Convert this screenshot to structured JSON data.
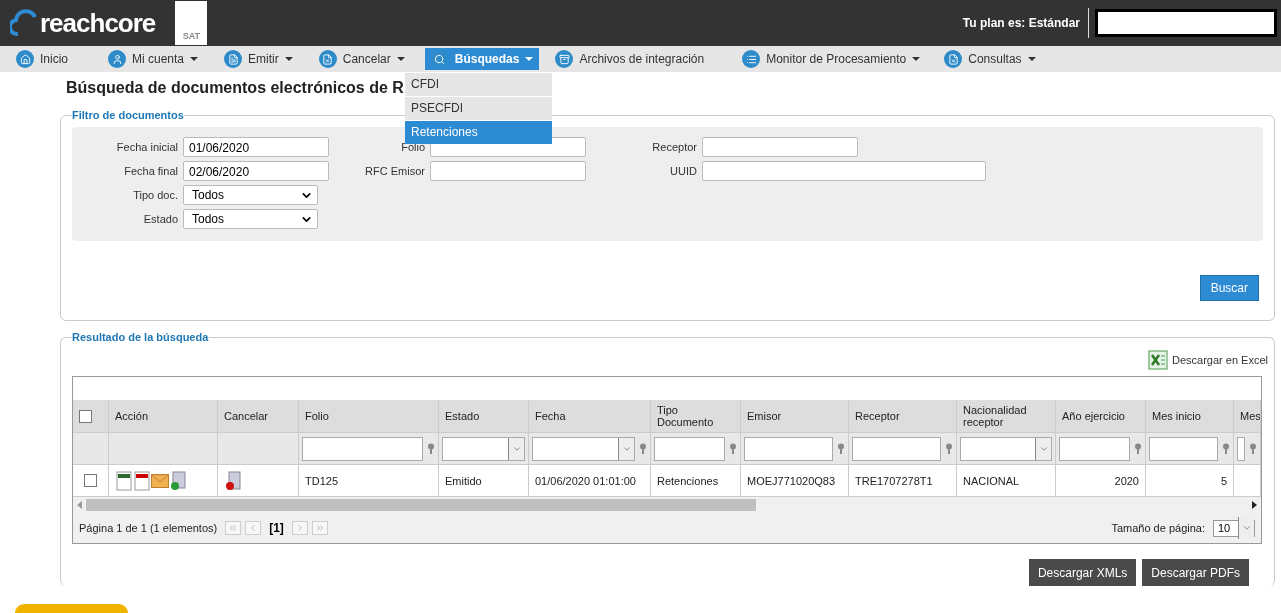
{
  "header": {
    "logo": "reachcore",
    "badge": "SAT",
    "plan": "Tu plan es: Estándar"
  },
  "nav": [
    {
      "label": "Inicio",
      "dropdown": false,
      "selected": false
    },
    {
      "label": "Mi cuenta",
      "dropdown": true,
      "selected": false
    },
    {
      "label": "Emitir",
      "dropdown": true,
      "selected": false
    },
    {
      "label": "Cancelar",
      "dropdown": true,
      "selected": false
    },
    {
      "label": "Búsquedas",
      "dropdown": true,
      "selected": true
    },
    {
      "label": "Archivos de integración",
      "dropdown": false,
      "selected": false
    },
    {
      "label": "Monitor de Procesamiento",
      "dropdown": true,
      "selected": false
    },
    {
      "label": "Consultas",
      "dropdown": true,
      "selected": false
    }
  ],
  "menu": [
    {
      "label": "CFDI",
      "selected": false
    },
    {
      "label": "PSECFDI",
      "selected": false
    },
    {
      "label": "Retenciones",
      "selected": true
    }
  ],
  "title": "Búsqueda de documentos electrónicos de R",
  "filter": {
    "legend": "Filtro de documentos",
    "rows": [
      [
        {
          "label": "Fecha inicial",
          "kind": "text",
          "value": "01/06/2020"
        },
        {
          "label": "Folio",
          "kind": "text"
        },
        {
          "label": "Receptor",
          "kind": "text"
        }
      ],
      [
        {
          "label": "Fecha final",
          "kind": "text",
          "value": "02/06/2020"
        },
        {
          "label": "RFC Emisor",
          "kind": "text"
        },
        {
          "label": "UUID",
          "kind": "wide"
        }
      ],
      [
        {
          "label": "Tipo doc.",
          "kind": "select",
          "value": "Todos"
        }
      ],
      [
        {
          "label": "Estado",
          "kind": "select",
          "value": "Todos"
        }
      ]
    ],
    "button": "Buscar"
  },
  "results": {
    "legend": "Resultado de la búsqueda",
    "excel": "Descargar en Excel",
    "columns": [
      {
        "kind": "check"
      },
      {
        "label": "Acción",
        "kind": "actions"
      },
      {
        "label": "Cancelar",
        "kind": "cancel"
      },
      {
        "label": "Folio",
        "kind": "text"
      },
      {
        "label": "Estado",
        "kind": "text"
      },
      {
        "label": "Fecha",
        "kind": "text"
      },
      {
        "label": "Tipo Documento",
        "kind": "text"
      },
      {
        "label": "Emisor",
        "kind": "text"
      },
      {
        "label": "Receptor",
        "kind": "text"
      },
      {
        "label": "Nacionalidad receptor",
        "kind": "text"
      },
      {
        "label": "Año ejercicio",
        "kind": "number"
      },
      {
        "label": "Mes inicio",
        "kind": "number"
      },
      {
        "label": "Mes",
        "kind": "text"
      }
    ],
    "filters": [
      {
        "kind": "none"
      },
      {
        "kind": "none"
      },
      {
        "kind": "none"
      },
      {
        "kind": "text"
      },
      {
        "kind": "select"
      },
      {
        "kind": "select-funnel"
      },
      {
        "kind": "text"
      },
      {
        "kind": "text"
      },
      {
        "kind": "text"
      },
      {
        "kind": "select"
      },
      {
        "kind": "text"
      },
      {
        "kind": "text"
      },
      {
        "kind": "text"
      }
    ],
    "rows": [
      {
        "checked": false,
        "cells": [
          "",
          "",
          "",
          "TD125",
          "Emitido",
          "01/06/2020 01:01:00",
          "Retenciones",
          "MOEJ771020Q83",
          "TRE1707278T1",
          "NACIONAL",
          "2020",
          "5",
          ""
        ]
      }
    ],
    "header_checked": false,
    "pager": {
      "info": "Página 1 de 1 (1 elementos)",
      "current": "[1]",
      "size_label": "Tamaño de página:",
      "size": "10"
    },
    "buttons": [
      "Descargar XMLs",
      "Descargar PDFs"
    ]
  }
}
